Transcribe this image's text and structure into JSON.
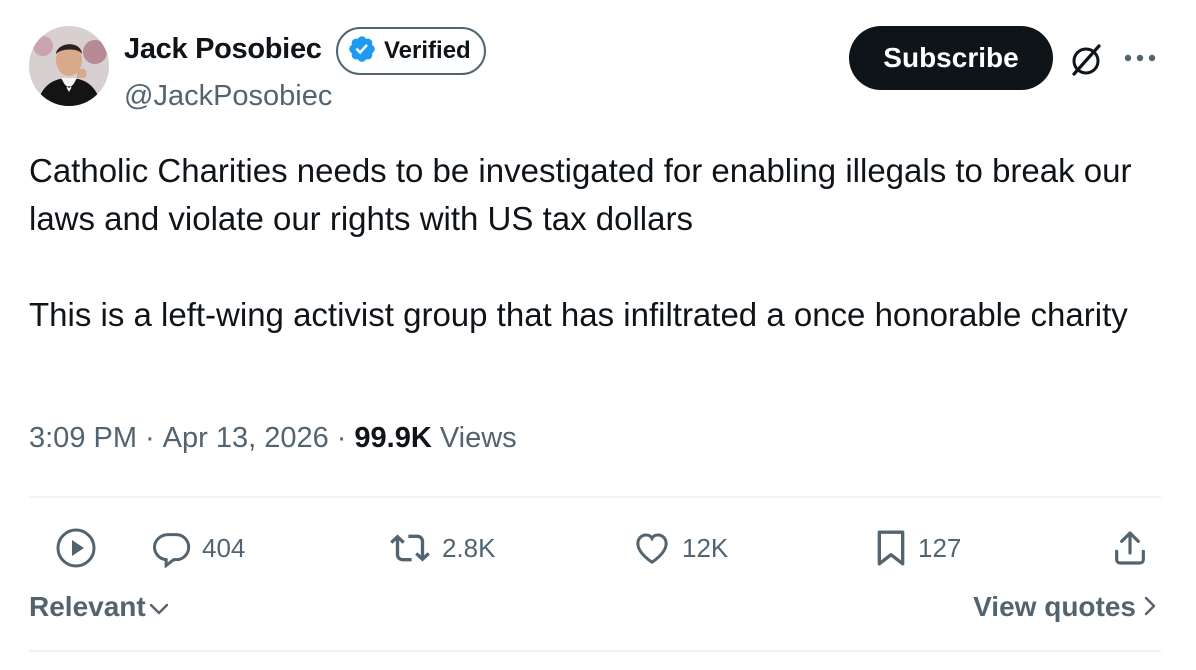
{
  "author": {
    "name": "Jack Posobiec",
    "verified_label": "Verified",
    "handle": "@JackPosobiec"
  },
  "header": {
    "subscribe_label": "Subscribe",
    "grok_icon": "grok-icon",
    "more_icon": "more-icon"
  },
  "tweet": {
    "paragraphs": [
      "Catholic Charities needs to be investigated for enabling illegals to break our laws and violate our rights with US tax dollars",
      "This is a left-wing activist group that has infiltrated a once honorable charity"
    ],
    "time": "3:09 PM",
    "separator": "·",
    "date": "Apr 13, 2026",
    "views_count": "99.9K",
    "views_label": "Views"
  },
  "actions": {
    "replies": "404",
    "reposts": "2.8K",
    "likes": "12K",
    "bookmarks": "127"
  },
  "footer": {
    "sort_label": "Relevant",
    "view_quotes_label": "View quotes"
  },
  "colors": {
    "text": "#0f1419",
    "secondary": "#536471",
    "verified_blue": "#1d9bf0",
    "divider": "#eff3f4"
  }
}
